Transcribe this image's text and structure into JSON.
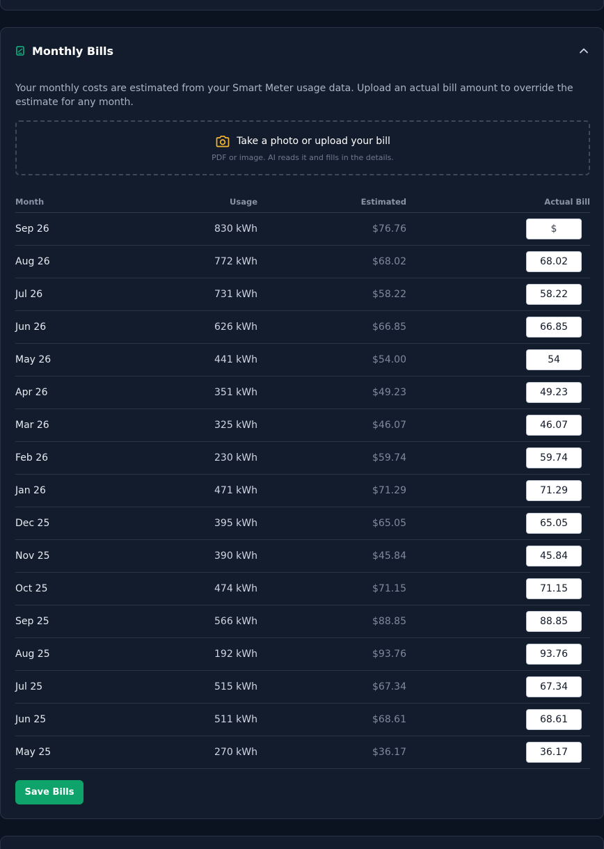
{
  "section": {
    "title": "Monthly Bills",
    "description": "Your monthly costs are estimated from your Smart Meter usage data. Upload an actual bill amount to override the estimate for any month.",
    "icons": {
      "title": "bill-icon",
      "collapse": "chevron-up-icon",
      "upload": "camera-icon"
    }
  },
  "upload": {
    "title": "Take a photo or upload your bill",
    "subtitle": "PDF or image. AI reads it and fills in the details."
  },
  "table": {
    "headers": {
      "month": "Month",
      "usage": "Usage",
      "estimated": "Estimated",
      "actual": "Actual Bill"
    },
    "actual_placeholder": "$",
    "rows": [
      {
        "month": "Sep 26",
        "usage": "830 kWh",
        "estimated": "$76.76",
        "actual": ""
      },
      {
        "month": "Aug 26",
        "usage": "772 kWh",
        "estimated": "$68.02",
        "actual": "68.02"
      },
      {
        "month": "Jul 26",
        "usage": "731 kWh",
        "estimated": "$58.22",
        "actual": "58.22"
      },
      {
        "month": "Jun 26",
        "usage": "626 kWh",
        "estimated": "$66.85",
        "actual": "66.85"
      },
      {
        "month": "May 26",
        "usage": "441 kWh",
        "estimated": "$54.00",
        "actual": "54"
      },
      {
        "month": "Apr 26",
        "usage": "351 kWh",
        "estimated": "$49.23",
        "actual": "49.23"
      },
      {
        "month": "Mar 26",
        "usage": "325 kWh",
        "estimated": "$46.07",
        "actual": "46.07"
      },
      {
        "month": "Feb 26",
        "usage": "230 kWh",
        "estimated": "$59.74",
        "actual": "59.74"
      },
      {
        "month": "Jan 26",
        "usage": "471 kWh",
        "estimated": "$71.29",
        "actual": "71.29"
      },
      {
        "month": "Dec 25",
        "usage": "395 kWh",
        "estimated": "$65.05",
        "actual": "65.05"
      },
      {
        "month": "Nov 25",
        "usage": "390 kWh",
        "estimated": "$45.84",
        "actual": "45.84"
      },
      {
        "month": "Oct 25",
        "usage": "474 kWh",
        "estimated": "$71.15",
        "actual": "71.15"
      },
      {
        "month": "Sep 25",
        "usage": "566 kWh",
        "estimated": "$88.85",
        "actual": "88.85"
      },
      {
        "month": "Aug 25",
        "usage": "192 kWh",
        "estimated": "$93.76",
        "actual": "93.76"
      },
      {
        "month": "Jul 25",
        "usage": "515 kWh",
        "estimated": "$67.34",
        "actual": "67.34"
      },
      {
        "month": "Jun 25",
        "usage": "511 kWh",
        "estimated": "$68.61",
        "actual": "68.61"
      },
      {
        "month": "May 25",
        "usage": "270 kWh",
        "estimated": "$36.17",
        "actual": "36.17"
      }
    ]
  },
  "save_label": "Save Bills",
  "colors": {
    "accent": "#0ea36b",
    "icon": "#f5b731",
    "card": "#131c2c",
    "background": "#0b1220"
  }
}
